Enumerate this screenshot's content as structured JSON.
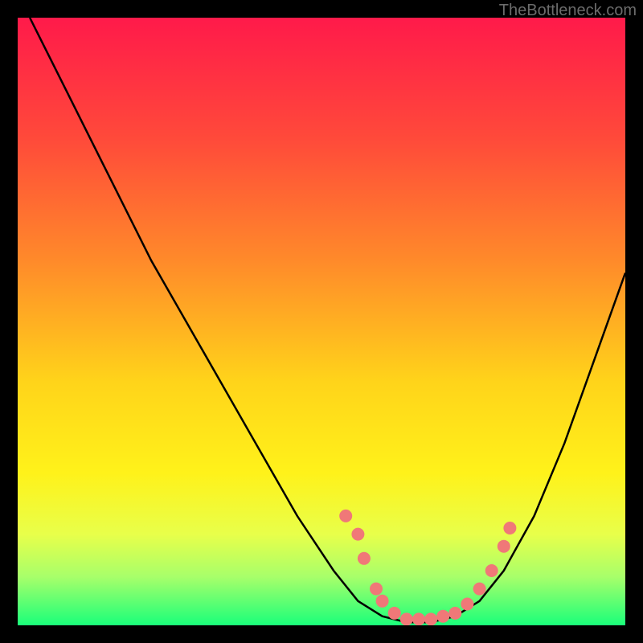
{
  "watermark": "TheBottleneck.com",
  "chart_data": {
    "type": "line",
    "title": "",
    "xlabel": "",
    "ylabel": "",
    "xlim": [
      0,
      100
    ],
    "ylim": [
      0,
      100
    ],
    "gradient_stops": [
      {
        "offset": 0,
        "color": "#ff1a4a"
      },
      {
        "offset": 20,
        "color": "#ff4a3a"
      },
      {
        "offset": 40,
        "color": "#ff8a2a"
      },
      {
        "offset": 60,
        "color": "#ffd41a"
      },
      {
        "offset": 75,
        "color": "#fff21a"
      },
      {
        "offset": 85,
        "color": "#e8ff4a"
      },
      {
        "offset": 92,
        "color": "#a8ff6a"
      },
      {
        "offset": 100,
        "color": "#1aff7a"
      }
    ],
    "curve": [
      {
        "x": 2,
        "y": 100
      },
      {
        "x": 4,
        "y": 96
      },
      {
        "x": 8,
        "y": 88
      },
      {
        "x": 15,
        "y": 74
      },
      {
        "x": 22,
        "y": 60
      },
      {
        "x": 30,
        "y": 46
      },
      {
        "x": 38,
        "y": 32
      },
      {
        "x": 46,
        "y": 18
      },
      {
        "x": 52,
        "y": 9
      },
      {
        "x": 56,
        "y": 4
      },
      {
        "x": 60,
        "y": 1.5
      },
      {
        "x": 64,
        "y": 0.5
      },
      {
        "x": 68,
        "y": 0.5
      },
      {
        "x": 72,
        "y": 1.5
      },
      {
        "x": 76,
        "y": 4
      },
      {
        "x": 80,
        "y": 9
      },
      {
        "x": 85,
        "y": 18
      },
      {
        "x": 90,
        "y": 30
      },
      {
        "x": 95,
        "y": 44
      },
      {
        "x": 100,
        "y": 58
      }
    ],
    "markers": [
      {
        "x": 54,
        "y": 18
      },
      {
        "x": 56,
        "y": 15
      },
      {
        "x": 57,
        "y": 11
      },
      {
        "x": 59,
        "y": 6
      },
      {
        "x": 60,
        "y": 4
      },
      {
        "x": 62,
        "y": 2
      },
      {
        "x": 64,
        "y": 1
      },
      {
        "x": 66,
        "y": 1
      },
      {
        "x": 68,
        "y": 1
      },
      {
        "x": 70,
        "y": 1.5
      },
      {
        "x": 72,
        "y": 2
      },
      {
        "x": 74,
        "y": 3.5
      },
      {
        "x": 76,
        "y": 6
      },
      {
        "x": 78,
        "y": 9
      },
      {
        "x": 80,
        "y": 13
      },
      {
        "x": 81,
        "y": 16
      }
    ],
    "marker_color": "#f07878",
    "marker_radius": 8
  }
}
